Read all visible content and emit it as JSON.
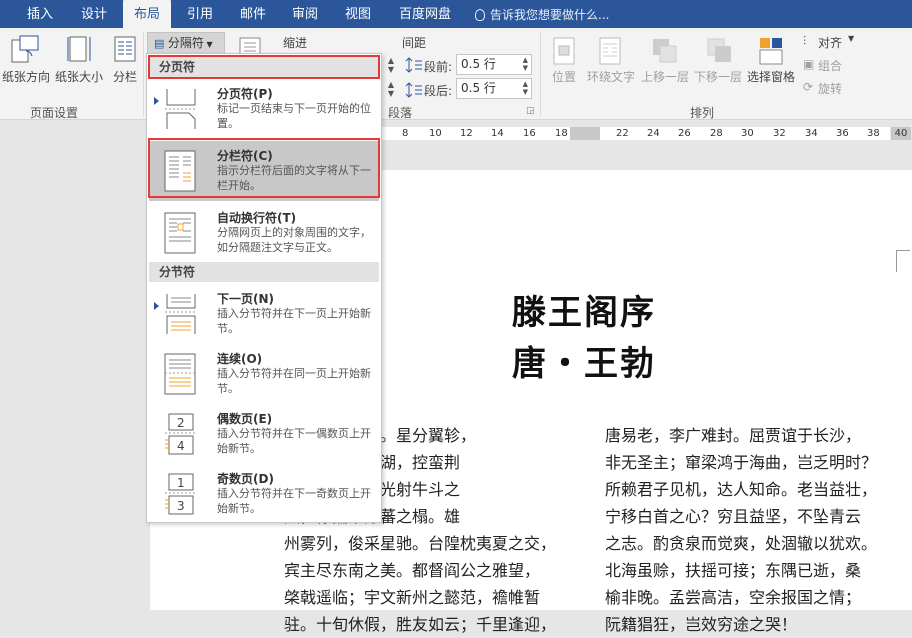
{
  "tabs": [
    "插入",
    "设计",
    "布局",
    "引用",
    "邮件",
    "审阅",
    "视图",
    "百度网盘"
  ],
  "active_tab": "布局",
  "tell_me": "告诉我您想要做什么...",
  "ribbon": {
    "orientation": "纸张方向",
    "size": "纸张大小",
    "columns": "分栏",
    "breaks": "分隔符",
    "page_setup": "页面设置",
    "indent": "缩进",
    "spacing": "间距",
    "before_label": "段前:",
    "before_value": "0.5 行",
    "after_label": "段后:",
    "after_value": "0.5 行",
    "paragraph": "段落",
    "position": "位置",
    "wrap_text": "环绕文字",
    "bring_forward": "上移一层",
    "send_backward": "下移一层",
    "selection_pane": "选择窗格",
    "align": "对齐",
    "group": "组合",
    "rotate": "旋转",
    "arrange": "排列"
  },
  "ruler": [
    "8",
    "10",
    "12",
    "14",
    "16",
    "18",
    "22",
    "24",
    "26",
    "28",
    "30",
    "32",
    "34",
    "36",
    "38",
    "40"
  ],
  "breaks_menu": {
    "page_breaks_header": "分页符",
    "section_breaks_header": "分节符",
    "items": [
      {
        "title": "分页符(P)",
        "desc": "标记一页结束与下一页开始的位置。"
      },
      {
        "title": "分栏符(C)",
        "desc": "指示分栏符后面的文字将从下一栏开始。"
      },
      {
        "title": "自动换行符(T)",
        "desc": "分隔网页上的对象周围的文字，如分隔题注文字与正文。"
      },
      {
        "title": "下一页(N)",
        "desc": "插入分节符并在下一页上开始新节。"
      },
      {
        "title": "连续(O)",
        "desc": "插入分节符并在同一页上开始新节。"
      },
      {
        "title": "偶数页(E)",
        "desc": "插入分节符并在下一偶数页上开始新节。"
      },
      {
        "title": "奇数页(D)",
        "desc": "插入分节符并在下一奇数页上开始新节。"
      }
    ]
  },
  "document": {
    "title": "滕王阁序",
    "author": "唐・王勃",
    "left_column": [
      "郡，洪都新府。星分翼轸，",
      "襟三江而带五湖，控蛮荆",
      "物华天宝，龙光射牛斗之",
      "杰，徐孺下陈蕃之榻。雄",
      "州雾列，俊采星驰。台隍枕夷夏之交，",
      "宾主尽东南之美。都督阎公之雅望，",
      "棨戟遥临；宇文新州之懿范，襜帷暂",
      "驻。十旬休假，胜友如云；千里逢迎，"
    ],
    "right_column": [
      "唐易老，李广难封。屈贾谊于长沙，",
      "非无圣主；窜梁鸿于海曲，岂乏明时？",
      "所赖君子见机，达人知命。老当益壮，",
      "宁移白首之心？穷且益坚，不坠青云",
      "之志。酌贪泉而觉爽，处涸辙以犹欢。",
      "北海虽赊，扶摇可接；东隅已逝，桑",
      "榆非晚。孟尝高洁，空余报国之情；",
      "阮籍猖狂，岂效穷途之哭！"
    ]
  }
}
